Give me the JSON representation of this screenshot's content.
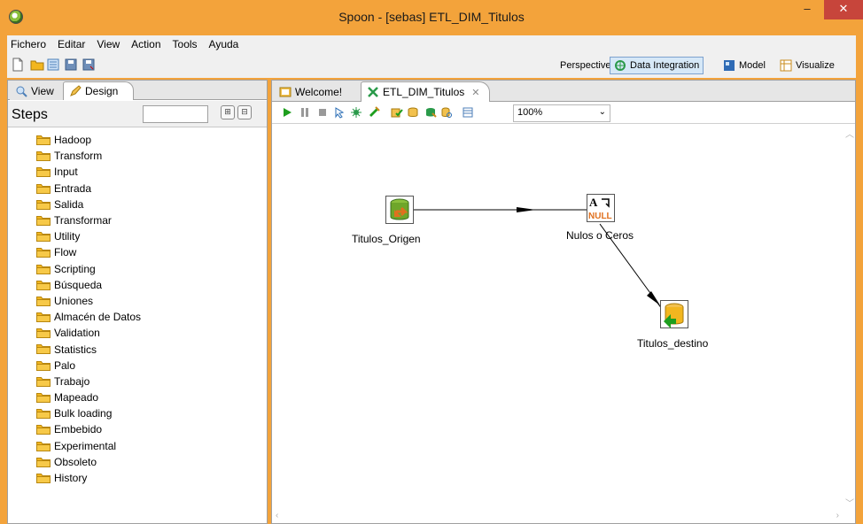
{
  "window": {
    "title": "Spoon - [sebas] ETL_DIM_Titulos",
    "minimize": "‒",
    "close": "✕"
  },
  "menu": [
    "Fichero",
    "Editar",
    "View",
    "Action",
    "Tools",
    "Ayuda"
  ],
  "perspective": {
    "label": "Perspective:",
    "options": [
      {
        "label": "Data Integration",
        "active": true
      },
      {
        "label": "Model",
        "active": false
      },
      {
        "label": "Visualize",
        "active": false
      }
    ]
  },
  "left_panel": {
    "tabs": [
      "View",
      "Design"
    ],
    "steps_title": "Steps",
    "search_value": "",
    "categories": [
      "Hadoop",
      "Transform",
      "Input",
      "Entrada",
      "Salida",
      "Transformar",
      "Utility",
      "Flow",
      "Scripting",
      "Búsqueda",
      "Uniones",
      "Almacén de Datos",
      "Validation",
      "Statistics",
      "Palo",
      "Trabajo",
      "Mapeado",
      "Bulk loading",
      "Embebido",
      "Experimental",
      "Obsoleto",
      "History"
    ]
  },
  "editor": {
    "tabs": [
      {
        "label": "Welcome!"
      },
      {
        "label": "ETL_DIM_Titulos",
        "close": "✕"
      }
    ],
    "zoom": "100%",
    "zoom_arrow": "⌄"
  },
  "canvas": {
    "steps": [
      {
        "name": "Titulos_Origen"
      },
      {
        "name": "Nulos o Ceros"
      },
      {
        "name": "Titulos_destino"
      }
    ]
  },
  "colors": {
    "title_bar": "#f3a33b",
    "folder": "#f2b61f",
    "run": "#1e9e1e",
    "perspective_active": "#d6e8f7"
  }
}
